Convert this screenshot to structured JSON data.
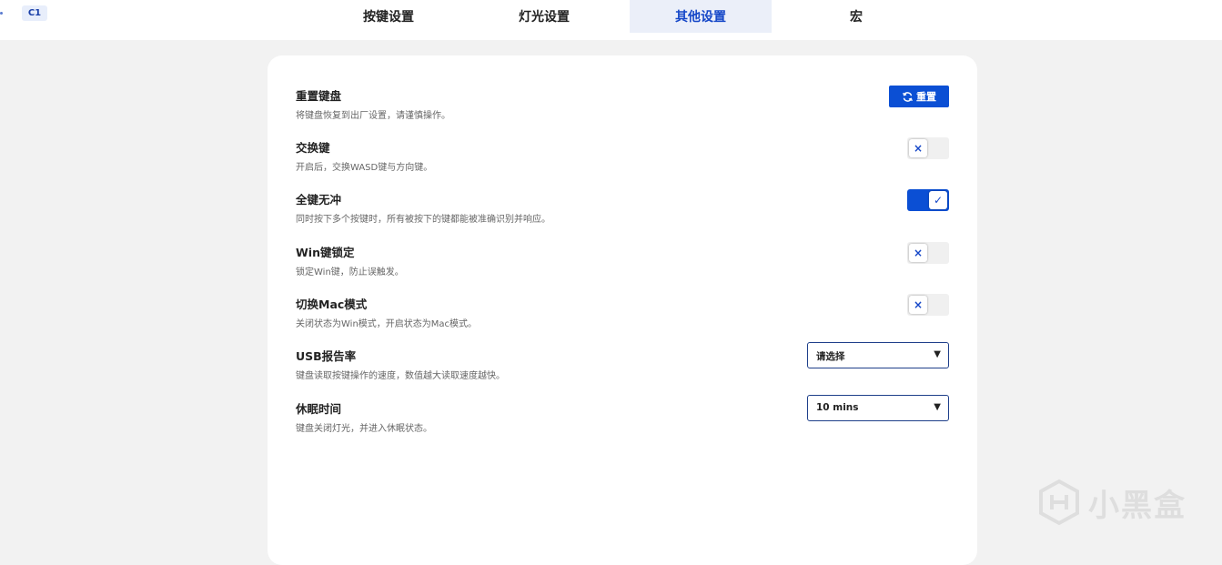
{
  "device": {
    "badge": "C1"
  },
  "tabs": [
    {
      "label": "按键设置",
      "active": false
    },
    {
      "label": "灯光设置",
      "active": false
    },
    {
      "label": "其他设置",
      "active": true
    },
    {
      "label": "宏",
      "active": false
    }
  ],
  "settings": {
    "reset": {
      "title": "重置键盘",
      "desc": "将键盘恢复到出厂设置，请谨慎操作。",
      "button_label": "重置"
    },
    "swap": {
      "title": "交换键",
      "desc": "开启后，交换WASD键与方向键。",
      "state": "off",
      "glyph": "×"
    },
    "nkro": {
      "title": "全键无冲",
      "desc": "同时按下多个按键时，所有被按下的键都能被准确识别并响应。",
      "state": "on",
      "glyph": "✓"
    },
    "winlock": {
      "title": "Win键锁定",
      "desc": "锁定Win键，防止误触发。",
      "state": "off",
      "glyph": "×"
    },
    "macmode": {
      "title": "切换Mac模式",
      "desc": "关闭状态为Win模式，开启状态为Mac模式。",
      "state": "off",
      "glyph": "×"
    },
    "usb_rate": {
      "title": "USB报告率",
      "desc": "键盘读取按键操作的速度，数值越大读取速度越快。",
      "selected": "请选择",
      "caret": "▼"
    },
    "sleep": {
      "title": "休眠时间",
      "desc": "键盘关闭灯光，并进入休眠状态。",
      "selected": "10 mins",
      "caret": "▼"
    }
  },
  "watermark": {
    "text": "小黑盒"
  },
  "colors": {
    "accent": "#0b4fd4",
    "active_tab_bg": "#ebeff9",
    "page_bg": "#f2f2f2"
  }
}
